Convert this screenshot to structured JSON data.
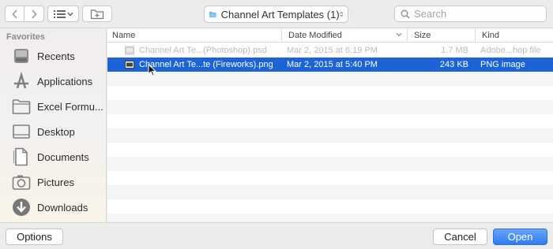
{
  "toolbar": {
    "path_label": "Channel Art Templates (1)",
    "search_placeholder": "Search"
  },
  "sidebar": {
    "header": "Favorites",
    "items": [
      {
        "label": "Recents",
        "icon": "recents-icon"
      },
      {
        "label": "Applications",
        "icon": "applications-icon"
      },
      {
        "label": "Excel Formu...",
        "icon": "folder-icon"
      },
      {
        "label": "Desktop",
        "icon": "desktop-icon"
      },
      {
        "label": "Documents",
        "icon": "documents-icon"
      },
      {
        "label": "Pictures",
        "icon": "pictures-icon"
      },
      {
        "label": "Downloads",
        "icon": "downloads-icon"
      }
    ]
  },
  "filelist": {
    "columns": {
      "name": "Name",
      "date": "Date Modified",
      "size": "Size",
      "kind": "Kind"
    },
    "rows": [
      {
        "name": "Channel Art Te...(Photoshop).psd",
        "date": "Mar 2, 2015 at 6:19 PM",
        "size": "1.7 MB",
        "kind": "Adobe...hop file",
        "state": "disabled"
      },
      {
        "name": "Channel Art Te...te (Fireworks).png",
        "date": "Mar 2, 2015 at 5:40 PM",
        "size": "243 KB",
        "kind": "PNG image",
        "state": "selected"
      }
    ]
  },
  "buttons": {
    "options": "Options",
    "cancel": "Cancel",
    "open": "Open"
  },
  "colors": {
    "selection": "#1c63d5",
    "primary_button": "#2d7cf3",
    "folder": "#6fb6ef"
  }
}
